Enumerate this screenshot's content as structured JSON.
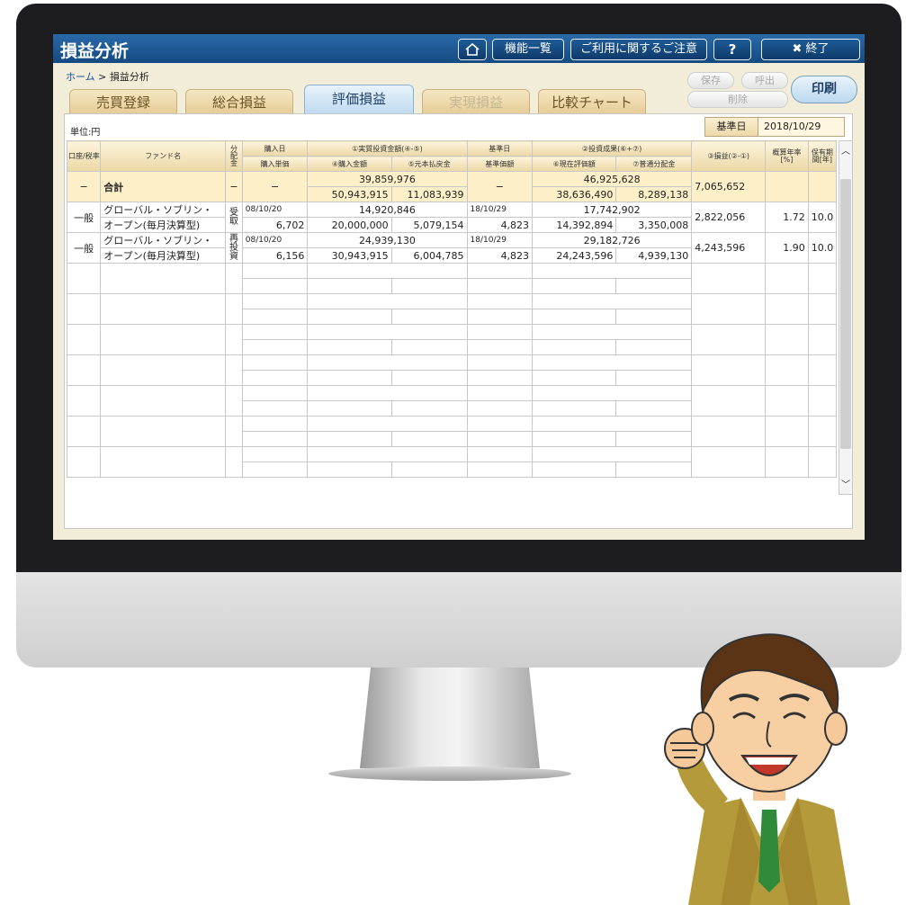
{
  "app": {
    "title": "損益分析",
    "home_icon": "house-icon",
    "menu_label": "機能一覧",
    "notice_label": "ご利用に関するご注意",
    "help_label": "?",
    "close_label": "✖ 終了"
  },
  "breadcrumb": {
    "home": "ホーム",
    "sep": ">",
    "current": "損益分析"
  },
  "tabs": [
    {
      "label": "売買登録"
    },
    {
      "label": "総合損益"
    },
    {
      "label": "評価損益"
    },
    {
      "label": "実現損益"
    },
    {
      "label": "比較チャート"
    }
  ],
  "buttons": {
    "save": "保存",
    "recall": "呼出",
    "delete": "削除",
    "print": "印刷"
  },
  "unit_label": "単位:円",
  "base_date": {
    "label": "基準日",
    "value": "2018/10/29"
  },
  "headers": {
    "account_tax": "口座/税率",
    "fund_name": "ファンド名",
    "distribution": "分配金",
    "purchase_date": "購入日",
    "purchase_price": "購入単価",
    "actual_investment": "①実質投資金額(④-⑤)",
    "purchase_amount": "④購入金額",
    "principal_refund": "⑤元本払戻金",
    "base_day": "基準日",
    "base_price": "基準価額",
    "investment_result": "②投資成果(⑥+⑦)",
    "current_value": "⑥現在評価額",
    "ordinary_dist": "⑦普通分配金",
    "profit_loss": "③損益(②-①)",
    "annual_rate": "概算年率[%]",
    "holding_period": "保有期間[年]"
  },
  "total": {
    "account": "−",
    "name": "合計",
    "distribution": "−",
    "purchase_date": "−",
    "actual_investment": "39,859,976",
    "purchase_amount": "50,943,915",
    "principal_refund": "11,083,939",
    "base_day": "−",
    "investment_result": "46,925,628",
    "current_value": "38,636,490",
    "ordinary_dist": "8,289,138",
    "profit_loss": "7,065,652"
  },
  "rows": [
    {
      "account": "一般",
      "name_line1": "グローバル・ソブリン・",
      "name_line2": "オープン(毎月決算型)",
      "distribution": "受取",
      "purchase_date": "08/10/20",
      "purchase_price": "6,702",
      "actual_investment": "14,920,846",
      "purchase_amount": "20,000,000",
      "principal_refund": "5,079,154",
      "base_day": "18/10/29",
      "base_price": "4,823",
      "investment_result": "17,742,902",
      "current_value": "14,392,894",
      "ordinary_dist": "3,350,008",
      "profit_loss": "2,822,056",
      "annual_rate": "1.72",
      "holding_period": "10.0"
    },
    {
      "account": "一般",
      "name_line1": "グローバル・ソブリン・",
      "name_line2": "オープン(毎月決算型)",
      "distribution": "再投資",
      "purchase_date": "08/10/20",
      "purchase_price": "6,156",
      "actual_investment": "24,939,130",
      "purchase_amount": "30,943,915",
      "principal_refund": "6,004,785",
      "base_day": "18/10/29",
      "base_price": "4,823",
      "investment_result": "29,182,726",
      "current_value": "24,243,596",
      "ordinary_dist": "4,939,130",
      "profit_loss": "4,243,596",
      "annual_rate": "1.90",
      "holding_period": "10.0"
    }
  ],
  "empty_rows": 7,
  "scroll_icons": {
    "up": "chevron-up-icon",
    "down": "chevron-down-icon"
  },
  "mascot": "cheering-businessman-illustration"
}
